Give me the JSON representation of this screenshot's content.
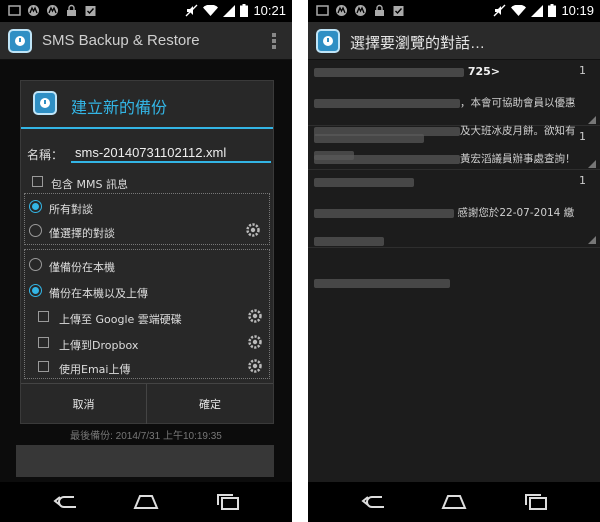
{
  "colors": {
    "accent": "#33b5e5",
    "background": "#1c1c1c",
    "bar": "#2a2a2a"
  },
  "left": {
    "status_time": "10:21",
    "app_title": "SMS Backup & Restore",
    "dialog": {
      "title": "建立新的備份",
      "name_label": "名稱：",
      "name_value": "sms-20140731102112.xml",
      "include_mms": "包含 MMS 訊息",
      "all_conversations": "所有對談",
      "selected_conversations": "僅選擇的對談",
      "backup_local": "僅備份在本機",
      "backup_local_upload": "備份在本機以及上傳",
      "upload_google": "上傳至 Google 雲端硬碟",
      "upload_dropbox": "上傳到Dropbox",
      "upload_email": "使用Emai上傳",
      "cancel": "取消",
      "ok": "確定"
    },
    "last_backup": "最後備份: 2014/7/31 上午10:19:35"
  },
  "right": {
    "status_time": "10:19",
    "title": "選擇要瀏覽的對話…",
    "conversations": [
      {
        "header_tail": "725>",
        "count": "1",
        "line1_tail": "，本會可協助會員以優惠",
        "line2_tail": "及大班冰皮月餅。欲知有",
        "line3_tail": "黃宏滔議員辦事處查詢！"
      },
      {
        "header_tail": "",
        "count": "1",
        "line1_tail": ""
      },
      {
        "header_tail": "",
        "count": "1",
        "line1_tail": "感謝您於22-07-2014 繳"
      }
    ]
  },
  "icons": {
    "app": "sms-backup-app-icon",
    "gear": "gear-icon",
    "overflow": "overflow-menu-icon",
    "back": "back-icon",
    "home": "home-icon",
    "recents": "recents-icon"
  }
}
